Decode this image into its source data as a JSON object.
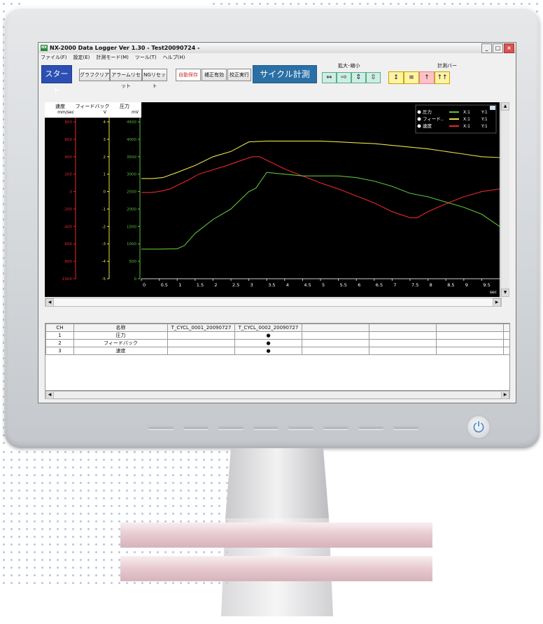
{
  "app": {
    "title": "NX-2000 Data Logger  Ver 1.30  - Test20090724 -",
    "icon_label": "NX"
  },
  "menu": [
    "ファイル(F)",
    "設定(E)",
    "計測モード(M)",
    "ツール(T)",
    "ヘルプ(H)"
  ],
  "window_buttons": {
    "minimize": "_",
    "maximize": "□",
    "close": "×"
  },
  "toolbar": {
    "start": "スタート",
    "graph_clear": "グラフクリア",
    "alarm_reset": "アラームリセット",
    "ng_reset": "NGリセット",
    "auto_save": "自動保存",
    "correction_enabled": "補正有効",
    "calibration_run": "校正実行",
    "cycle_measure": "サイクル計測",
    "zoom_label": "拡大･縮小",
    "measure_bar_label": "計測バー"
  },
  "colors": {
    "pressure": "#e8262c",
    "feedback": "#e6e04a",
    "speed": "#5cc13c",
    "plot_bg": "#000000",
    "start_btn": "#2c4fb4"
  },
  "chart_data": {
    "type": "line",
    "xlabel": "sec",
    "xlim": [
      0,
      10
    ],
    "xticks": [
      "0",
      "0.5",
      "1",
      "1.5",
      "2",
      "2.5",
      "3",
      "3.5",
      "4",
      "4.5",
      "5",
      "5.5",
      "6",
      "6.5",
      "7",
      "7.5",
      "8",
      "8.5",
      "9",
      "9.5"
    ],
    "axes": [
      {
        "name": "速度",
        "unit": "mm/sec",
        "color": "#e8262c",
        "ticks": [
          "800",
          "600",
          "400",
          "200",
          "0",
          "-200",
          "-400",
          "-600",
          "-800",
          "-1000"
        ]
      },
      {
        "name": "フィードバック",
        "unit": "V",
        "color": "#e6e04a",
        "ticks": [
          "4",
          "3",
          "2",
          "1",
          "0",
          "-1",
          "-2",
          "-3",
          "-4",
          "-5"
        ]
      },
      {
        "name": "圧力",
        "unit": "mV",
        "color": "#5cc13c",
        "ticks": [
          "4500",
          "4000",
          "3500",
          "3000",
          "2500",
          "2000",
          "1500",
          "1000",
          "500",
          "0"
        ]
      }
    ],
    "legend": [
      {
        "name": "圧力",
        "color": "#5cc13c",
        "x_scale": "X:1",
        "y_scale": "Y:1"
      },
      {
        "name": "フィード..",
        "color": "#e6e04a",
        "x_scale": "X:1",
        "y_scale": "Y:1"
      },
      {
        "name": "速度",
        "color": "#e8262c",
        "x_scale": "X:1",
        "y_scale": "Y:1"
      }
    ],
    "series": [
      {
        "name": "速度",
        "color": "#e8262c",
        "x": [
          0,
          0.2,
          0.4,
          0.6,
          0.8,
          1,
          1.3,
          1.6,
          2,
          2.4,
          2.8,
          3.1,
          3.3,
          3.6,
          4,
          4.5,
          5,
          5.5,
          6,
          6.5,
          7,
          7.5,
          7.7,
          8,
          8.5,
          9,
          9.5,
          10
        ],
        "y": [
          -10,
          -10,
          -5,
          10,
          30,
          70,
          130,
          200,
          250,
          300,
          360,
          400,
          400,
          340,
          260,
          180,
          100,
          30,
          -50,
          -130,
          -230,
          -300,
          -300,
          -230,
          -140,
          -60,
          0,
          30
        ]
      },
      {
        "name": "フィードバック",
        "color": "#e6e04a",
        "x": [
          0,
          0.3,
          0.6,
          1,
          1.5,
          2,
          2.5,
          3,
          3.5,
          4,
          4.5,
          5,
          5.5,
          6,
          6.5,
          7,
          7.5,
          8,
          8.5,
          9,
          9.5,
          10
        ],
        "y": [
          0.75,
          0.75,
          0.8,
          1.1,
          1.5,
          2.0,
          2.3,
          2.85,
          2.9,
          2.9,
          2.9,
          2.9,
          2.85,
          2.8,
          2.75,
          2.65,
          2.55,
          2.45,
          2.3,
          2.15,
          2.0,
          1.95
        ]
      },
      {
        "name": "圧力",
        "color": "#5cc13c",
        "x": [
          0,
          0.5,
          1,
          1.2,
          1.5,
          2,
          2.5,
          3,
          3.2,
          3.5,
          4,
          4.5,
          5,
          5.5,
          6,
          6.5,
          7,
          7.5,
          8,
          8.5,
          9,
          9.5,
          10
        ],
        "y": [
          850,
          850,
          860,
          950,
          1300,
          1700,
          2000,
          2500,
          2600,
          3050,
          3000,
          2950,
          2950,
          2950,
          2900,
          2800,
          2650,
          2450,
          2350,
          2200,
          2050,
          1850,
          1500
        ]
      }
    ]
  },
  "table": {
    "headers": [
      "CH",
      "名称",
      "T_CYCL_0001_20090727",
      "T_CYCL_0002_20090727",
      "",
      "",
      "",
      ""
    ],
    "rows": [
      {
        "ch": "1",
        "name": "圧力",
        "c1": "",
        "c2": "●"
      },
      {
        "ch": "2",
        "name": "フィードバック",
        "c1": "",
        "c2": "●"
      },
      {
        "ch": "3",
        "name": "速度",
        "c1": "",
        "c2": "●"
      }
    ]
  }
}
